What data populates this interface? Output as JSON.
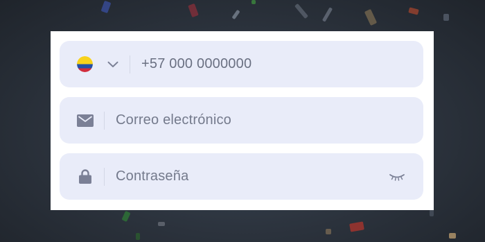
{
  "form": {
    "phone": {
      "country_flag": "colombia-flag-icon",
      "value": "+57 000 0000000"
    },
    "email": {
      "placeholder": "Correo electrónico"
    },
    "password": {
      "placeholder": "Contraseña"
    }
  },
  "colors": {
    "field_bg": "#e9ecf9",
    "icon": "#7b8096",
    "text": "#747a8c"
  }
}
